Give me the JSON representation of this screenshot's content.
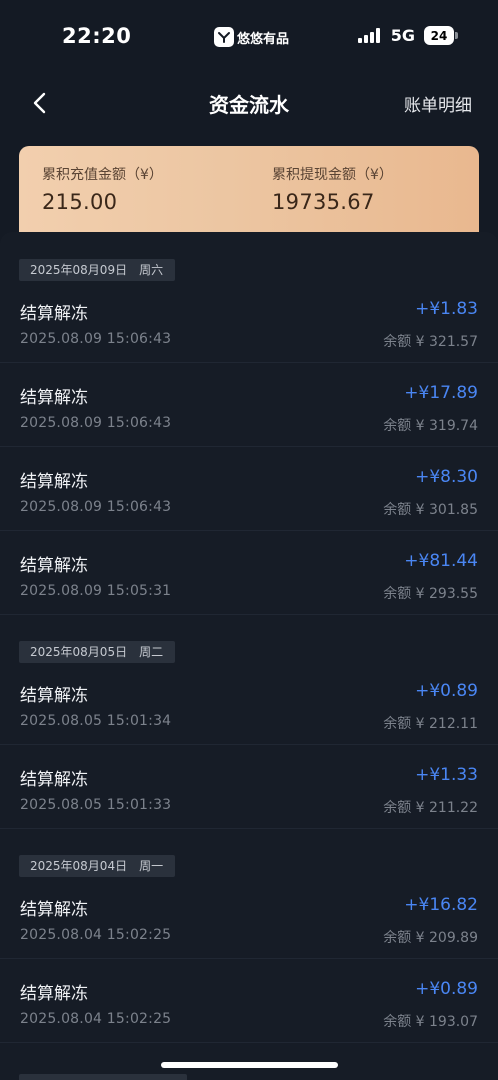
{
  "status_bar": {
    "time": "22:20",
    "app_name": "悠悠有品",
    "network": "5G",
    "battery": "24"
  },
  "nav": {
    "title": "资金流水",
    "action": "账单明细",
    "back_icon": "chevron-left-icon"
  },
  "summary": {
    "recharge_label": "累积充值金额（¥）",
    "recharge_value": "215.00",
    "withdraw_label": "累积提现金额（¥）",
    "withdraw_value": "19735.67"
  },
  "colors": {
    "background": "#141a24",
    "accent_amount": "#4a86f3",
    "card_gradient_start": "#f2cfae",
    "card_gradient_end": "#e9b88f"
  },
  "sections": [
    {
      "date": "2025年08月09日",
      "weekday": "周六",
      "rows": [
        {
          "title": "结算解冻",
          "time": "2025.08.09 15:06:43",
          "amount": "+¥1.83",
          "balance": "余额 ¥ 321.57"
        },
        {
          "title": "结算解冻",
          "time": "2025.08.09 15:06:43",
          "amount": "+¥17.89",
          "balance": "余额 ¥ 319.74"
        },
        {
          "title": "结算解冻",
          "time": "2025.08.09 15:06:43",
          "amount": "+¥8.30",
          "balance": "余额 ¥ 301.85"
        },
        {
          "title": "结算解冻",
          "time": "2025.08.09 15:05:31",
          "amount": "+¥81.44",
          "balance": "余额 ¥ 293.55"
        }
      ]
    },
    {
      "date": "2025年08月05日",
      "weekday": "周二",
      "rows": [
        {
          "title": "结算解冻",
          "time": "2025.08.05 15:01:34",
          "amount": "+¥0.89",
          "balance": "余额 ¥ 212.11"
        },
        {
          "title": "结算解冻",
          "time": "2025.08.05 15:01:33",
          "amount": "+¥1.33",
          "balance": "余额 ¥ 211.22"
        }
      ]
    },
    {
      "date": "2025年08月04日",
      "weekday": "周一",
      "rows": [
        {
          "title": "结算解冻",
          "time": "2025.08.04 15:02:25",
          "amount": "+¥16.82",
          "balance": "余额 ¥ 209.89"
        },
        {
          "title": "结算解冻",
          "time": "2025.08.04 15:02:25",
          "amount": "+¥0.89",
          "balance": "余额 ¥ 193.07"
        }
      ]
    }
  ]
}
